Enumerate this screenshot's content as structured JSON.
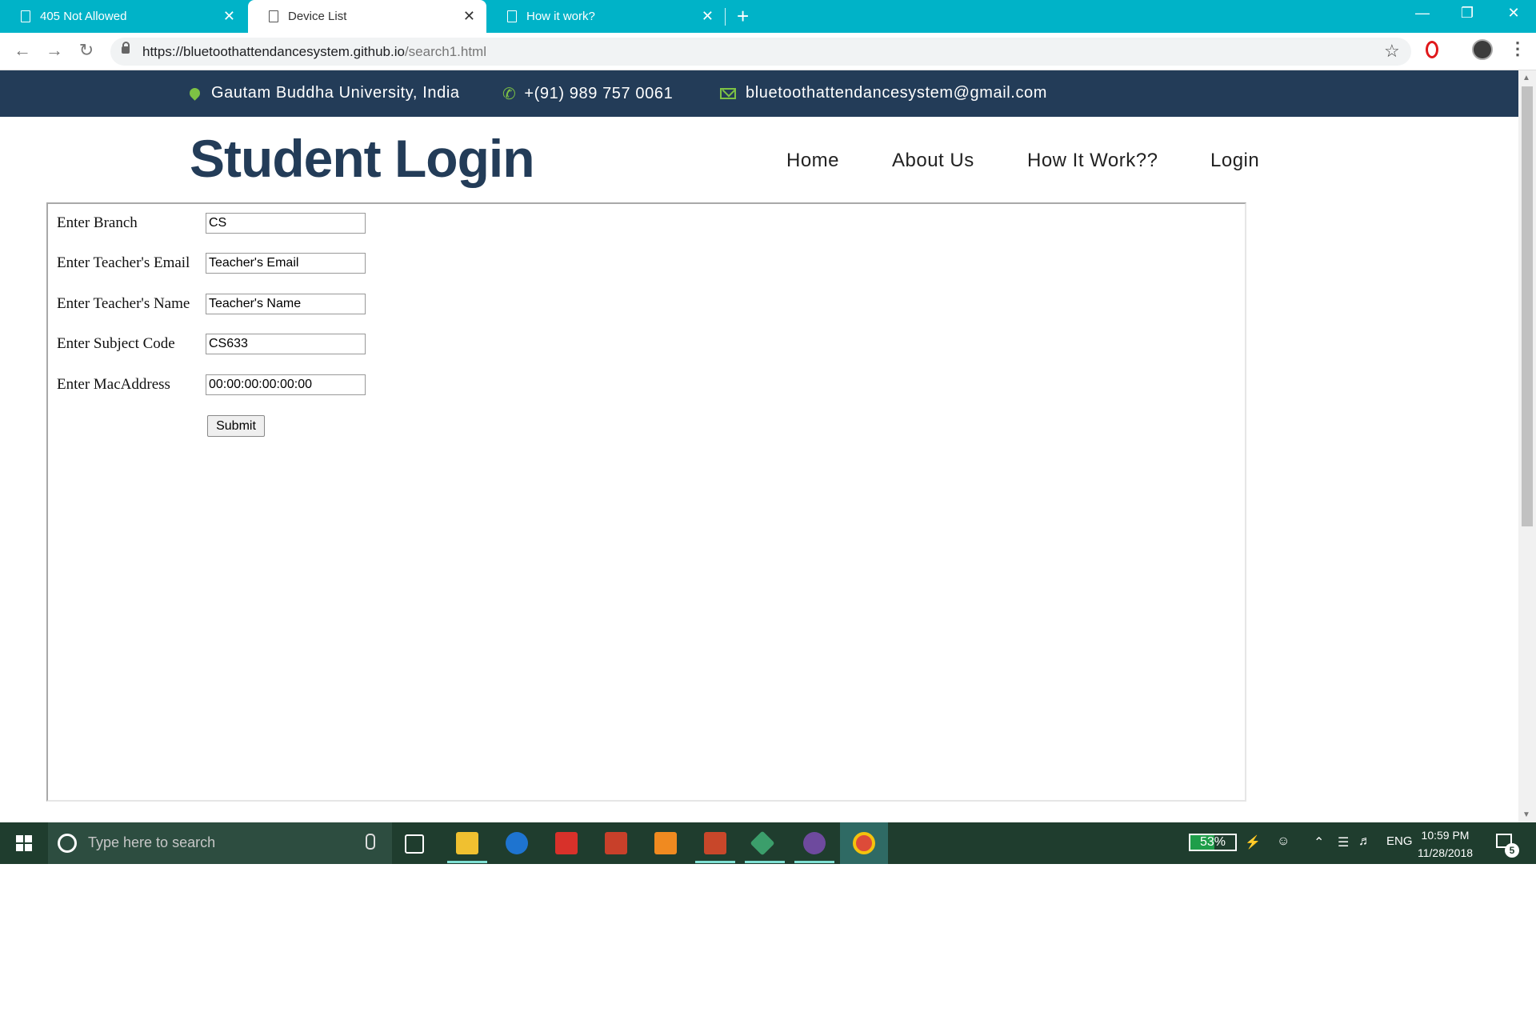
{
  "browser": {
    "tabs": [
      {
        "title": "405 Not Allowed",
        "active": false
      },
      {
        "title": "Device List",
        "active": true
      },
      {
        "title": "How it work?",
        "active": false
      }
    ],
    "url_host": "https://bluetoothattendancesystem.github.io",
    "url_path": "/search1.html",
    "new_tab": "+",
    "close_glyph": "✕"
  },
  "infobar": {
    "location": "Gautam Buddha University, India",
    "phone": "+(91) 989 757 0061",
    "email": "bluetoothattendancesystem@gmail.com"
  },
  "header": {
    "title": "Student Login",
    "nav": [
      "Home",
      "About Us",
      "How It Work??",
      "Login"
    ]
  },
  "form": {
    "fields": [
      {
        "label": "Enter Branch",
        "value": "CS"
      },
      {
        "label": "Enter Teacher's Email",
        "value": "Teacher's Email"
      },
      {
        "label": "Enter Teacher's Name",
        "value": "Teacher's Name"
      },
      {
        "label": "Enter Subject Code",
        "value": "CS633"
      },
      {
        "label": "Enter MacAddress",
        "value": "00:00:00:00:00:00"
      }
    ],
    "submit_label": "Submit"
  },
  "taskbar": {
    "search_placeholder": "Type here to search",
    "battery": "53%",
    "battery_level": 0.53,
    "language": "ENG",
    "time": "10:59 PM",
    "date": "11/28/2018",
    "notification_count": "5"
  },
  "colors": {
    "tab_strip": "#00b3c8",
    "infobar": "#233c58",
    "accent_green": "#7dc244",
    "brand": "#233c58"
  }
}
